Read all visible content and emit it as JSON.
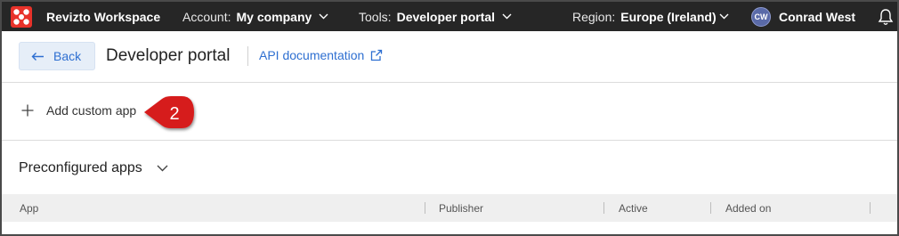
{
  "topbar": {
    "brand": "Revizto Workspace",
    "account_label": "Account:",
    "account_value": "My company",
    "tools_label": "Tools:",
    "tools_value": "Developer portal",
    "region_label": "Region:",
    "region_value": "Europe (Ireland)",
    "user_initials": "CW",
    "user_name": "Conrad West",
    "icons": [
      "revizto-logo-icon",
      "chevron-down-icon",
      "bell-icon"
    ]
  },
  "header": {
    "back_label": "Back",
    "title": "Developer portal",
    "api_link": "API documentation"
  },
  "actions": {
    "add_custom_app": "Add custom app",
    "callout_number": "2"
  },
  "section": {
    "title": "Preconfigured apps"
  },
  "table": {
    "columns": [
      "App",
      "Publisher",
      "Active",
      "Added on"
    ]
  },
  "colors": {
    "topbar_bg": "#262626",
    "brand_red": "#e8322a",
    "link_blue": "#2e6fd1",
    "back_bg": "#e6eef8",
    "callout_red": "#d61f1f",
    "table_header_bg": "#efefef"
  }
}
